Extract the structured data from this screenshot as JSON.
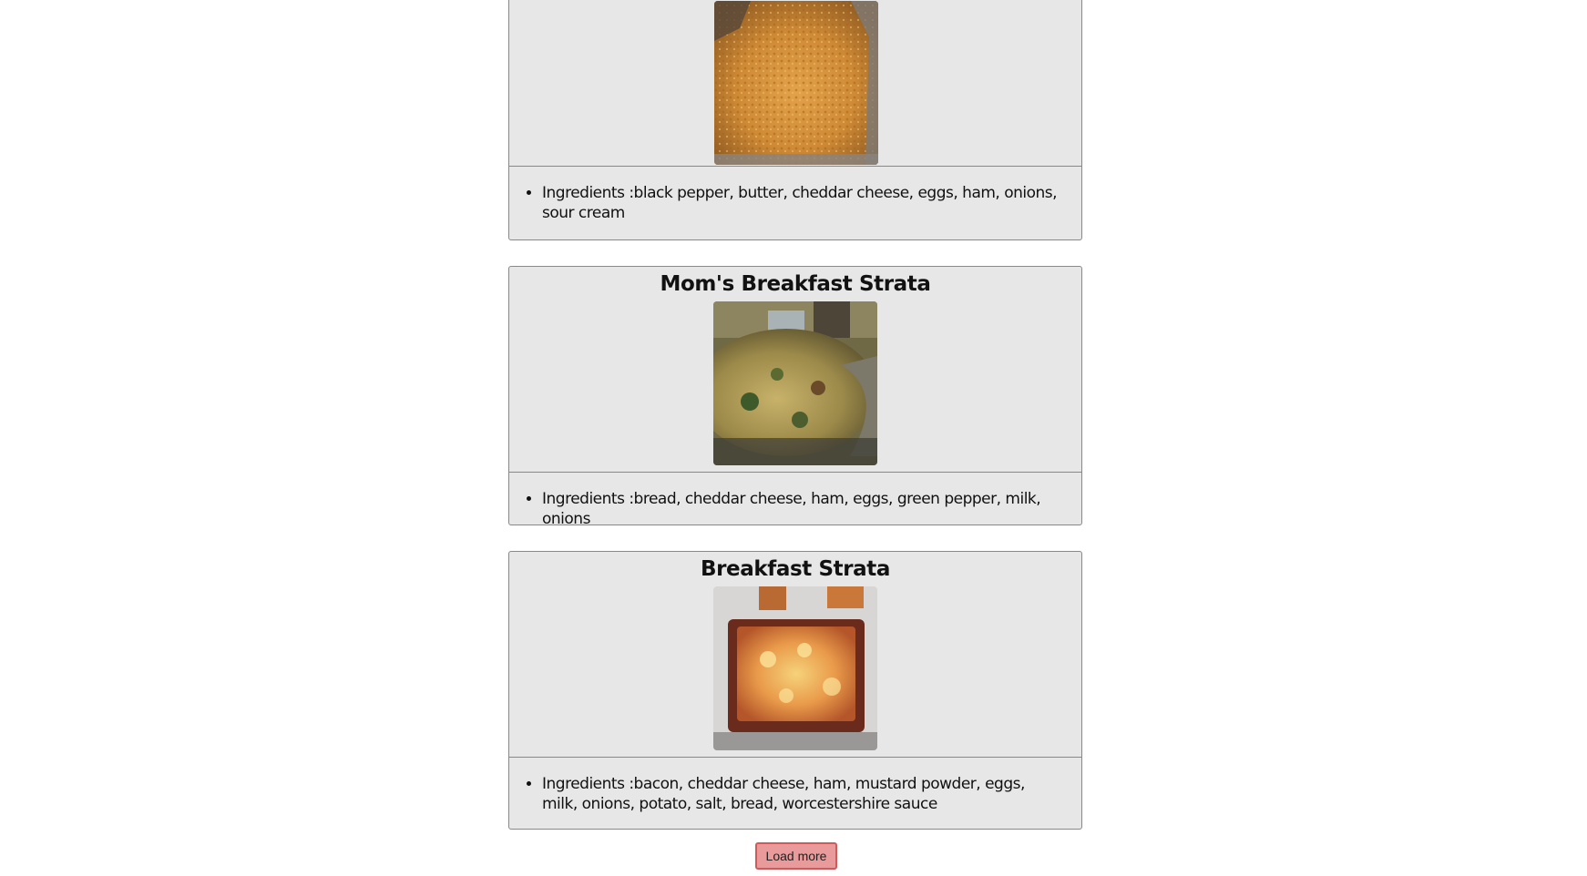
{
  "recipes": [
    {
      "title": "",
      "ingredients": "Ingredients :black pepper, butter, cheddar cheese, eggs, ham, onions, sour cream",
      "photo_icon": "casserole-photo"
    },
    {
      "title": "Mom's Breakfast Strata",
      "ingredients": "Ingredients :bread, cheddar cheese, ham, eggs, green pepper, milk, onions",
      "photo_icon": "strata-dish-photo"
    },
    {
      "title": "Breakfast Strata",
      "ingredients": "Ingredients :bacon, cheddar cheese, ham, mustard powder, eggs, milk, onions, potato, salt, bread, worcestershire sauce",
      "photo_icon": "baked-strata-photo"
    }
  ],
  "load_more": {
    "label": "Load more"
  },
  "colors": {
    "card_bg": "#e8e7e8",
    "card_border": "#888888",
    "button_bg": "#e99a9a",
    "button_border": "#d05a5a"
  }
}
